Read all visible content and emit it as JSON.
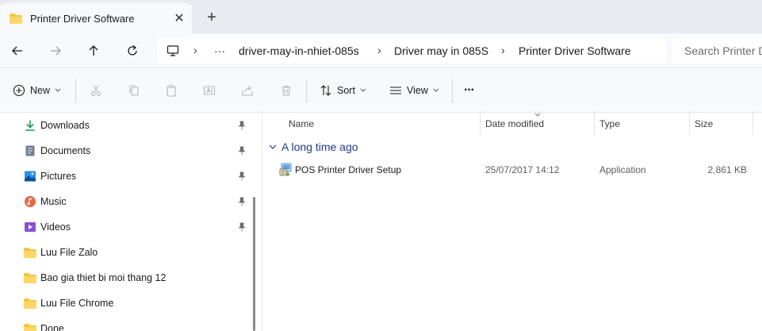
{
  "window": {
    "tab_title": "Printer Driver Software",
    "close_glyph": "✕",
    "add_glyph": "+"
  },
  "address": {
    "overflow": "···",
    "crumbs": [
      "driver-may-in-nhiet-085s",
      "Driver may in 085S",
      "Printer Driver Software"
    ],
    "search_placeholder": "Search Printer Driver Software"
  },
  "toolbar": {
    "new_label": "New",
    "sort_label": "Sort",
    "view_label": "View",
    "more_label": "···"
  },
  "sidebar": {
    "items": [
      {
        "label": "Downloads",
        "icon": "download-icon",
        "pinned": true
      },
      {
        "label": "Documents",
        "icon": "documents-icon",
        "pinned": true
      },
      {
        "label": "Pictures",
        "icon": "pictures-icon",
        "pinned": true
      },
      {
        "label": "Music",
        "icon": "music-icon",
        "pinned": true
      },
      {
        "label": "Videos",
        "icon": "videos-icon",
        "pinned": true
      },
      {
        "label": "Luu File Zalo",
        "icon": "folder-icon",
        "pinned": false
      },
      {
        "label": "Bao gia thiet bi moi thang 12",
        "icon": "folder-icon",
        "pinned": false
      },
      {
        "label": "Luu File Chrome",
        "icon": "folder-icon",
        "pinned": false
      },
      {
        "label": "Done",
        "icon": "folder-icon",
        "pinned": false
      }
    ]
  },
  "columns": {
    "name": "Name",
    "date": "Date modified",
    "type": "Type",
    "size": "Size"
  },
  "group": {
    "label": "A long time ago"
  },
  "files": [
    {
      "name": "POS Printer Driver Setup",
      "date": "25/07/2017 14:12",
      "type": "Application",
      "size": "2,861 KB"
    }
  ],
  "colors": {
    "accent": "#0067c0",
    "group_text": "#1f3a8a",
    "folder": "#f5c542"
  }
}
